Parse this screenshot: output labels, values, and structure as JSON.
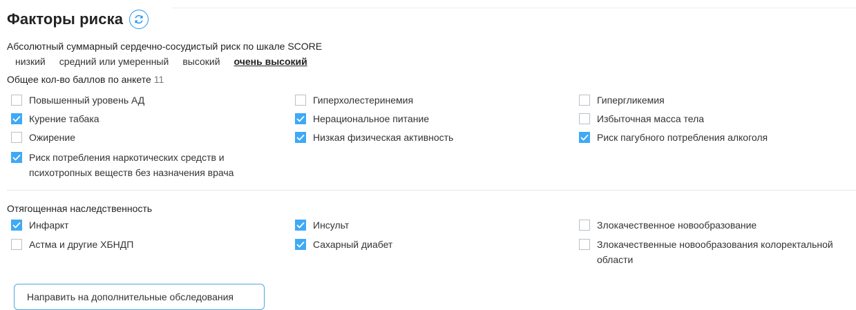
{
  "title": "Факторы риска",
  "score": {
    "label": "Абсолютный суммарный сердечно-сосудистый риск по шкале SCORE",
    "levels": [
      "низкий",
      "средний или умеренный",
      "высокий",
      "очень высокий"
    ],
    "selected": "очень высокий"
  },
  "total": {
    "label": "Общее кол-во баллов по анкете",
    "value": "11"
  },
  "risk_factors": [
    {
      "label": "Повышенный уровень АД",
      "checked": false
    },
    {
      "label": "Гиперхолестеринемия",
      "checked": false
    },
    {
      "label": "Гипергликемия",
      "checked": false
    },
    {
      "label": "Курение табака",
      "checked": true
    },
    {
      "label": "Нерациональное питание",
      "checked": true
    },
    {
      "label": "Избыточная масса тела",
      "checked": false
    },
    {
      "label": "Ожирение",
      "checked": false
    },
    {
      "label": "Низкая физическая активность",
      "checked": true
    },
    {
      "label": "Риск пагубного потребления алкоголя",
      "checked": true
    },
    {
      "label": "Риск потребления наркотических средств и\nпсихотропных веществ без назначения врача",
      "checked": true
    }
  ],
  "heredity": {
    "title": "Отягощенная наследственность",
    "items": [
      {
        "label": "Инфаркт",
        "checked": true
      },
      {
        "label": "Инсульт",
        "checked": true
      },
      {
        "label": "Злокачественное новообразование",
        "checked": false
      },
      {
        "label": "Астма и другие ХБНДП",
        "checked": false
      },
      {
        "label": "Сахарный диабет",
        "checked": true
      },
      {
        "label": "Злокачественные новообразования колоректальной\nобласти",
        "checked": false
      }
    ]
  },
  "action_button": "Направить на дополнительные обследования",
  "icons": {
    "refresh": "refresh-icon",
    "check": "check-icon"
  },
  "colors": {
    "accent": "#3fa9f5",
    "button_border": "#4aa8e0"
  }
}
